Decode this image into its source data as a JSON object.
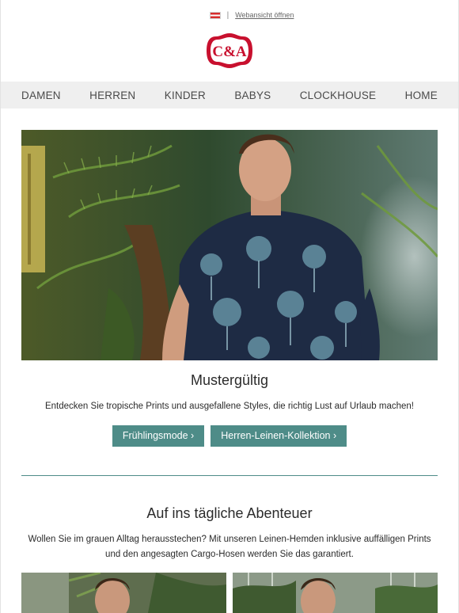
{
  "topbar": {
    "flag_icon": "austria-flag-icon",
    "separator": "|",
    "web_view_link": "Webansicht öffnen"
  },
  "logo": {
    "text": "C&A",
    "colors": {
      "ring": "#c8102e",
      "inner": "#ffffff"
    }
  },
  "nav": {
    "items": [
      "DAMEN",
      "HERREN",
      "KINDER",
      "BABYS",
      "CLOCKHOUSE",
      "HOME"
    ]
  },
  "hero": {
    "image": "man-in-tropical-palm-print-shirt-in-greenhouse",
    "title": "Mustergültig",
    "text": "Entdecken Sie tropische Prints und ausgefallene Styles, die richtig Lust auf Urlaub machen!",
    "buttons": [
      "Frühlingsmode ›",
      "Herren-Leinen-Kollektion ›"
    ]
  },
  "section2": {
    "title": "Auf ins tägliche Abenteuer",
    "text_line1": "Wollen Sie im grauen Alltag herausstechen? Mit unseren Leinen-Hemden inklusive auffälligen Prints",
    "text_line2": "und den angesagten Cargo-Hosen werden Sie das garantiert.",
    "images": [
      "man-in-greenhouse-photo-left",
      "man-in-greenhouse-photo-right"
    ]
  },
  "colors": {
    "accent": "#4e8c88",
    "nav_bg": "#efefef",
    "brand_red": "#c8102e"
  }
}
